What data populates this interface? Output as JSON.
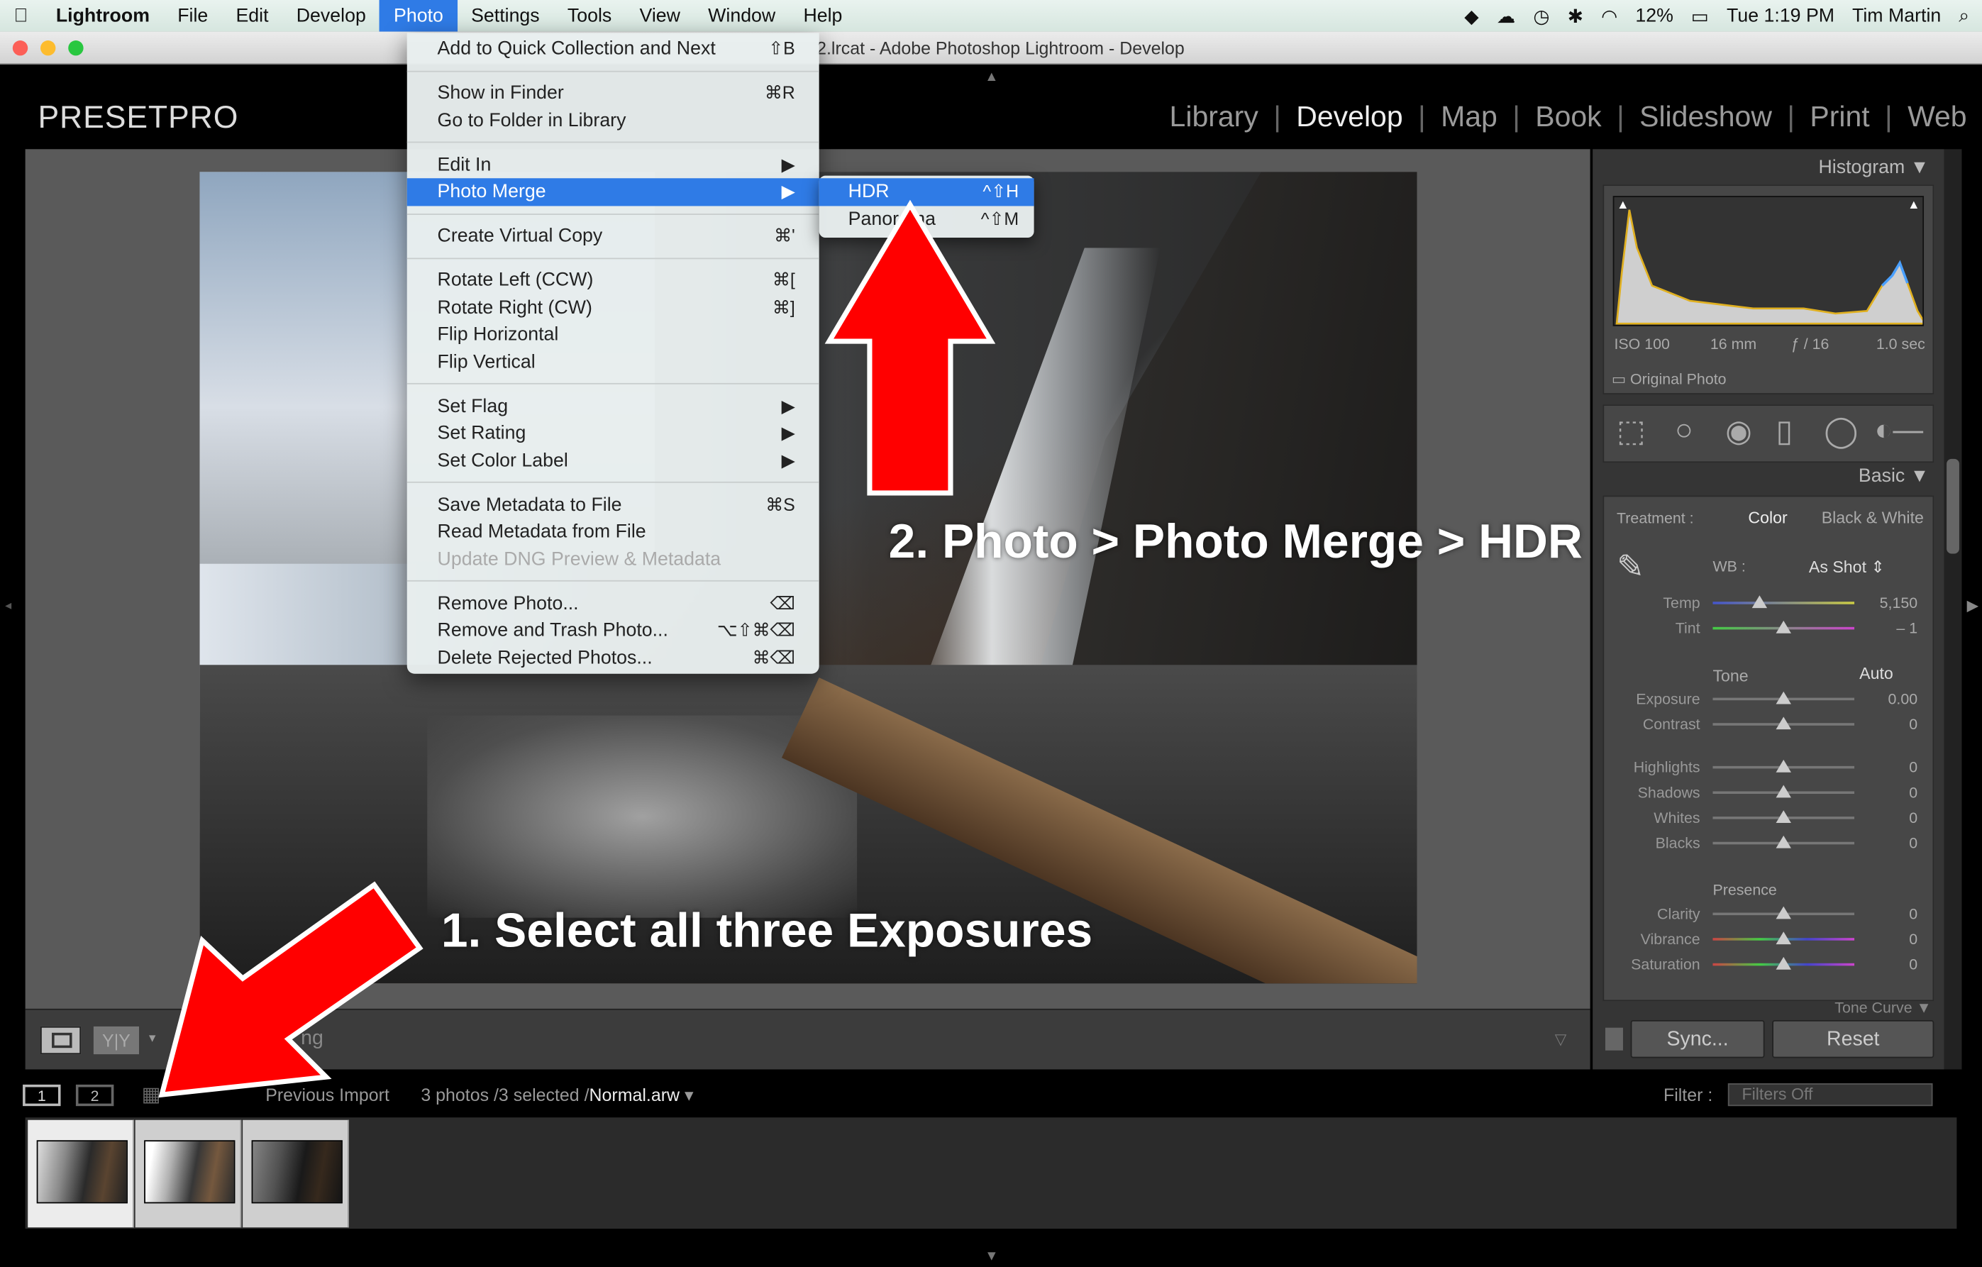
{
  "menubar": {
    "app": "Lightroom",
    "items": [
      "File",
      "Edit",
      "Develop",
      "Photo",
      "Settings",
      "Tools",
      "View",
      "Window",
      "Help"
    ],
    "active": "Photo",
    "battery": "12%",
    "clock": "Tue 1:19 PM",
    "user": "Tim Martin"
  },
  "window": {
    "title": "2.lrcat - Adobe Photoshop Lightroom - Develop"
  },
  "brand": "PRESETPRO",
  "modules": [
    "Library",
    "Develop",
    "Map",
    "Book",
    "Slideshow",
    "Print",
    "Web"
  ],
  "current_module": "Develop",
  "photo_menu": {
    "groups": [
      [
        {
          "label": "Add to Quick Collection and Next",
          "shortcut": "⇧B"
        }
      ],
      [
        {
          "label": "Show in Finder",
          "shortcut": "⌘R"
        },
        {
          "label": "Go to Folder in Library",
          "shortcut": ""
        }
      ],
      [
        {
          "label": "Edit In",
          "shortcut": "▶"
        },
        {
          "label": "Photo Merge",
          "shortcut": "▶",
          "highlighted": true
        }
      ],
      [
        {
          "label": "Create Virtual Copy",
          "shortcut": "⌘'"
        }
      ],
      [
        {
          "label": "Rotate Left (CCW)",
          "shortcut": "⌘["
        },
        {
          "label": "Rotate Right (CW)",
          "shortcut": "⌘]"
        },
        {
          "label": "Flip Horizontal",
          "shortcut": ""
        },
        {
          "label": "Flip Vertical",
          "shortcut": ""
        }
      ],
      [
        {
          "label": "Set Flag",
          "shortcut": "▶"
        },
        {
          "label": "Set Rating",
          "shortcut": "▶"
        },
        {
          "label": "Set Color Label",
          "shortcut": "▶"
        }
      ],
      [
        {
          "label": "Save Metadata to File",
          "shortcut": "⌘S"
        },
        {
          "label": "Read Metadata from File",
          "shortcut": ""
        },
        {
          "label": "Update DNG Preview & Metadata",
          "shortcut": "",
          "disabled": true
        }
      ],
      [
        {
          "label": "Remove Photo...",
          "shortcut": "⌫"
        },
        {
          "label": "Remove and Trash Photo...",
          "shortcut": "⌥⇧⌘⌫"
        },
        {
          "label": "Delete Rejected Photos...",
          "shortcut": "⌘⌫"
        }
      ]
    ]
  },
  "submenu": [
    {
      "label": "HDR",
      "shortcut": "^⇧H",
      "highlighted": true
    },
    {
      "label": "Panorama",
      "shortcut": "^⇧M"
    }
  ],
  "annotations": {
    "step1": "1. Select all three Exposures",
    "step2": "2. Photo > Photo Merge > HDR",
    "arrow_color": "#ff0000"
  },
  "histogram": {
    "title": "Histogram",
    "iso": "ISO 100",
    "focal": "16 mm",
    "aperture": "ƒ / 16",
    "shutter": "1.0 sec",
    "original_photo": "Original Photo"
  },
  "basic": {
    "title": "Basic",
    "treatment_label": "Treatment :",
    "color": "Color",
    "bw": "Black & White",
    "wb_label": "WB :",
    "wb_value": "As Shot",
    "tone_label": "Tone",
    "auto": "Auto",
    "presence_label": "Presence",
    "wb_sliders": [
      {
        "label": "Temp",
        "value": "5,150",
        "pos": 0.33
      },
      {
        "label": "Tint",
        "value": "– 1",
        "pos": 0.5
      }
    ],
    "tone_sliders": [
      {
        "label": "Exposure",
        "value": "0.00",
        "pos": 0.5
      },
      {
        "label": "Contrast",
        "value": "0",
        "pos": 0.5
      }
    ],
    "tone2_sliders": [
      {
        "label": "Highlights",
        "value": "0",
        "pos": 0.5
      },
      {
        "label": "Shadows",
        "value": "0",
        "pos": 0.5
      },
      {
        "label": "Whites",
        "value": "0",
        "pos": 0.5
      },
      {
        "label": "Blacks",
        "value": "0",
        "pos": 0.5
      }
    ],
    "presence_sliders": [
      {
        "label": "Clarity",
        "value": "0",
        "pos": 0.5
      },
      {
        "label": "Vibrance",
        "value": "0",
        "pos": 0.5
      },
      {
        "label": "Saturation",
        "value": "0",
        "pos": 0.5
      }
    ],
    "next_panel": "Tone Curve"
  },
  "buttons": {
    "sync": "Sync...",
    "reset": "Reset"
  },
  "toolbar": {
    "partial_text": "ng"
  },
  "filmstrip_bar": {
    "view1": "1",
    "view2": "2",
    "source": "Previous Import",
    "count": "3 photos /3 selected /",
    "filename": "Normal.arw",
    "filter_label": "Filter :",
    "filter_value": "Filters Off"
  },
  "thumbnails": [
    {
      "selected": true,
      "active": true
    },
    {
      "selected": true
    },
    {
      "selected": true
    }
  ]
}
